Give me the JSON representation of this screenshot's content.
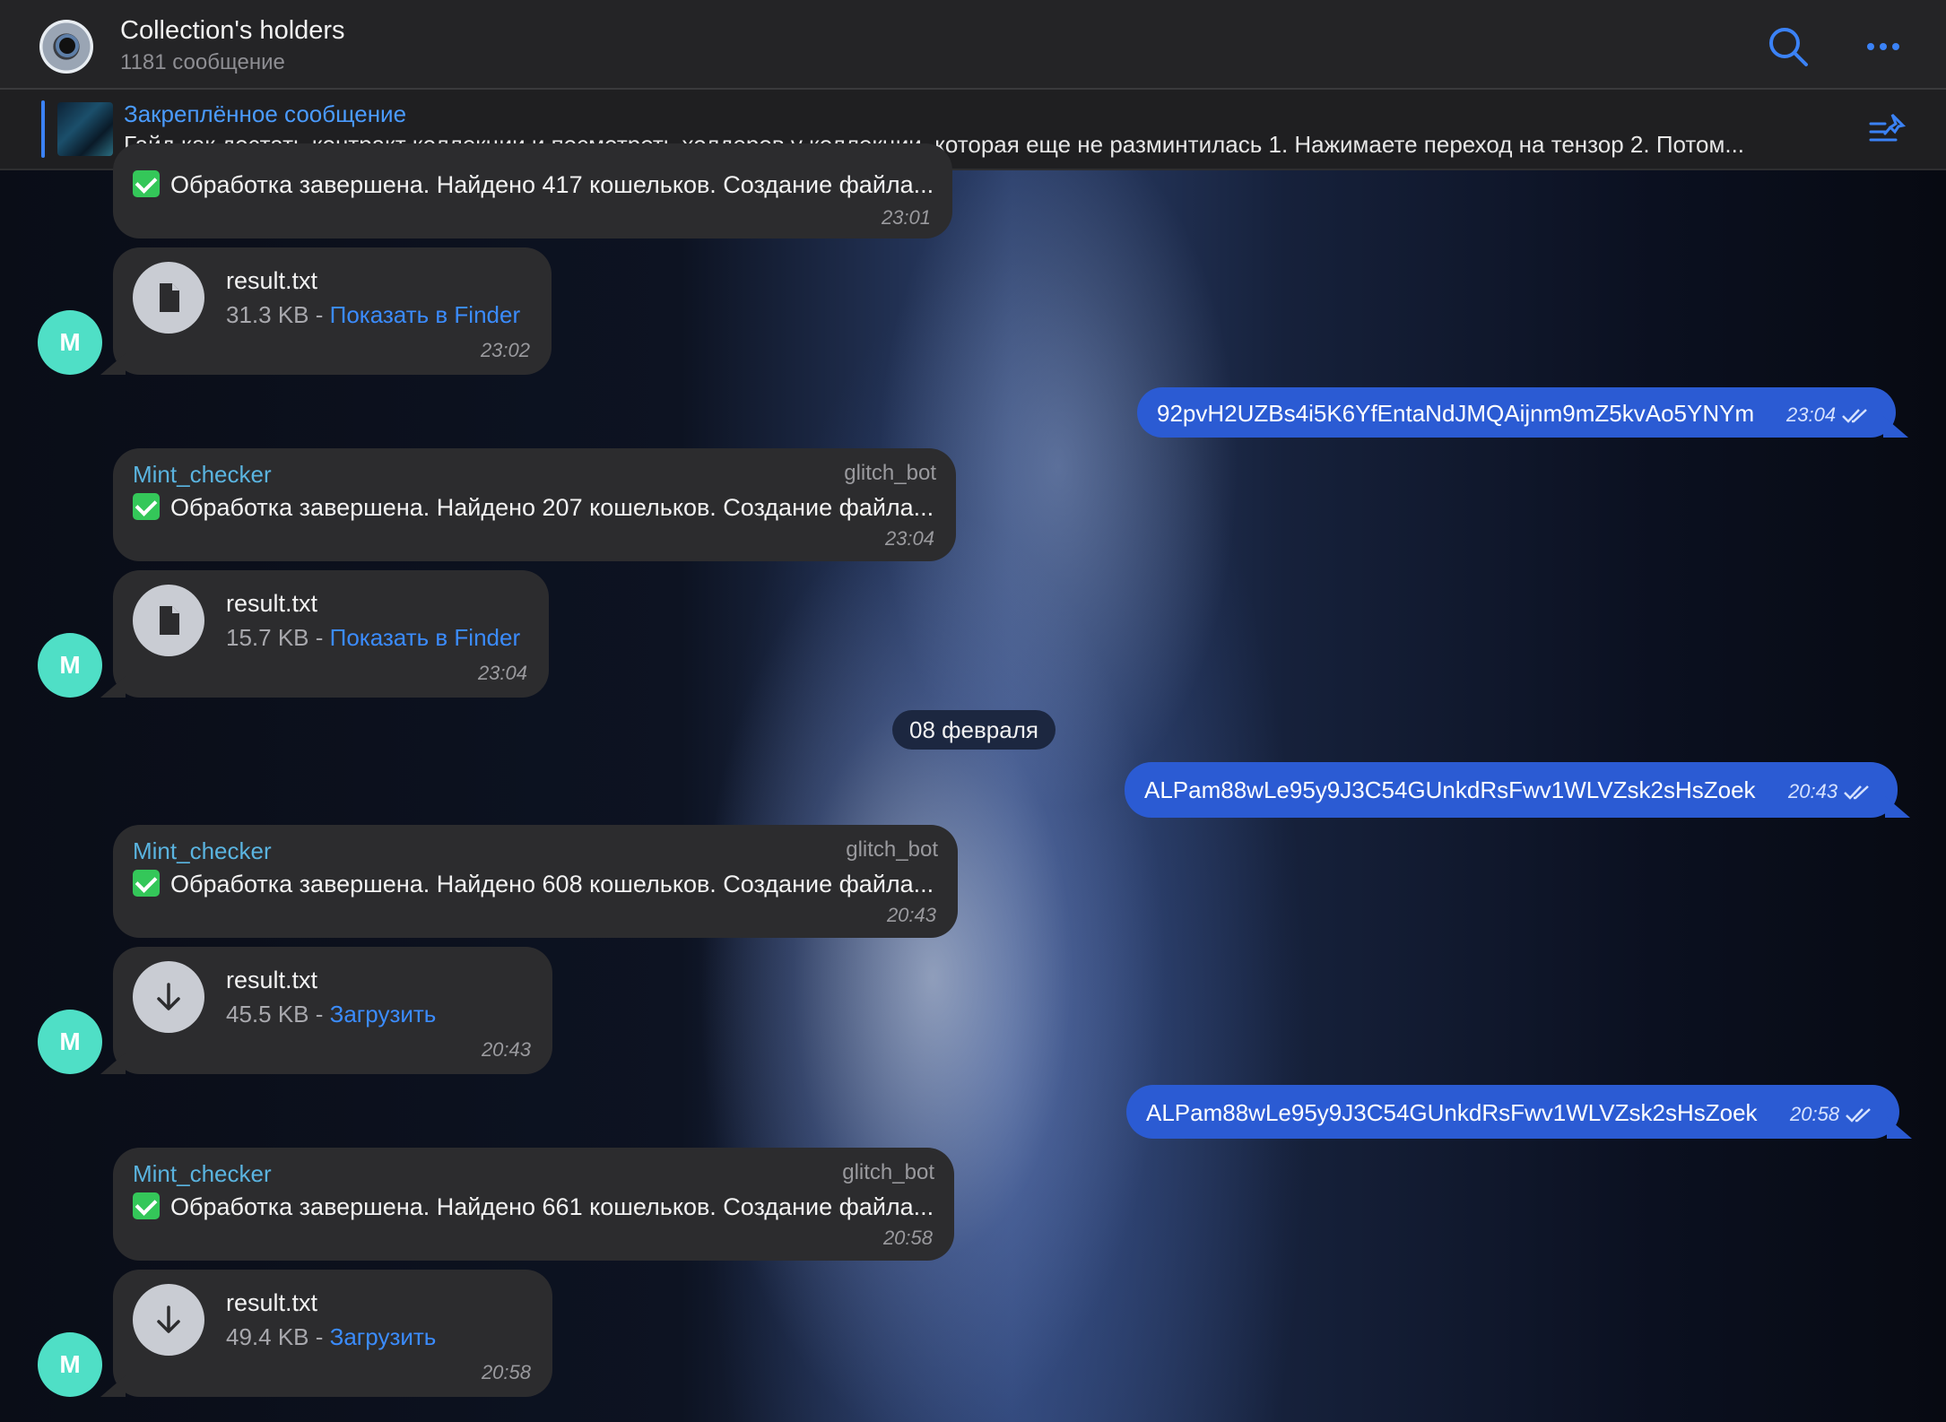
{
  "header": {
    "title": "Collection's holders",
    "subtitle": "1181 сообщение"
  },
  "pinned": {
    "title": "Закреплённое сообщение",
    "text": "Гайд как достать контракт коллекции и посмотреть холдеров у коллекции, которая еще не разминтилась  1. Нажимаете переход на тензор 2. Потом..."
  },
  "messages": {
    "m0": {
      "text": "Обработка завершена. Найдено 417 кошельков. Создание файла...",
      "time": "23:01"
    },
    "f0": {
      "name": "result.txt",
      "size": "31.3 KB",
      "sep": " - ",
      "link": "Показать в Finder",
      "time": "23:02",
      "avatar": "M"
    },
    "o0": {
      "text": "92pvH2UZBs4i5K6YfEntaNdJMQAijnm9mZ5kvAo5YNYm",
      "time": "23:04"
    },
    "m1": {
      "sender": "Mint_checker",
      "via": "glitch_bot",
      "text": "Обработка завершена. Найдено 207 кошельков. Создание файла...",
      "time": "23:04"
    },
    "f1": {
      "name": "result.txt",
      "size": "15.7 KB",
      "sep": " - ",
      "link": "Показать в Finder",
      "time": "23:04",
      "avatar": "M"
    },
    "date": "08 февраля",
    "o1": {
      "text": "ALPam88wLe95y9J3C54GUnkdRsFwv1WLVZsk2sHsZoek",
      "time": "20:43"
    },
    "m2": {
      "sender": "Mint_checker",
      "via": "glitch_bot",
      "text": "Обработка завершена. Найдено 608 кошельков. Создание файла...",
      "time": "20:43"
    },
    "f2": {
      "name": "result.txt",
      "size": "45.5 KB",
      "sep": " - ",
      "link": "Загрузить",
      "time": "20:43",
      "avatar": "M"
    },
    "o2": {
      "text": "ALPam88wLe95y9J3C54GUnkdRsFwv1WLVZsk2sHsZoek",
      "time": "20:58"
    },
    "m3": {
      "sender": "Mint_checker",
      "via": "glitch_bot",
      "text": "Обработка завершена. Найдено 661 кошельков. Создание файла...",
      "time": "20:58"
    },
    "f3": {
      "name": "result.txt",
      "size": "49.4 KB",
      "sep": " - ",
      "link": "Загрузить",
      "time": "20:58",
      "avatar": "M"
    }
  },
  "colors": {
    "accent": "#3b82f6",
    "outgoing_bubble": "#2b5bd3",
    "incoming_bubble": "#2c2c2e",
    "avatar": "#4fdfc6",
    "sender_name": "#5ab4e0"
  },
  "icons": [
    "eye-avatar-icon",
    "search-icon",
    "more-icon",
    "pinned-list-icon",
    "file-icon",
    "download-icon",
    "check-mark-icon",
    "double-check-icon"
  ]
}
